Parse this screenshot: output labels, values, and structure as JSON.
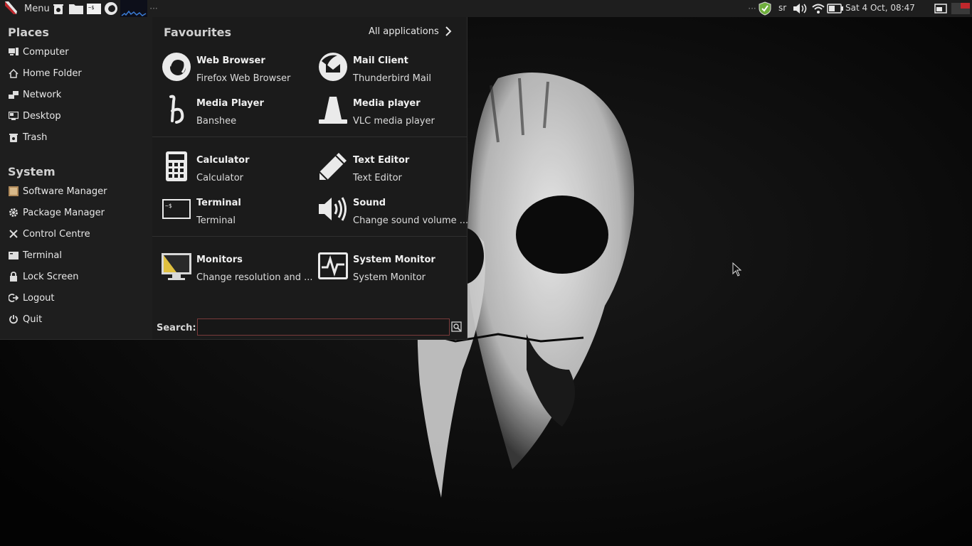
{
  "panel": {
    "menu_label": "Menu",
    "keyboard_layout": "sr",
    "clock": "Sat  4 Oct, 08:47",
    "launchers": [
      "trash-icon",
      "files-icon",
      "terminal-icon",
      "firefox-icon",
      "system-monitor-graph-icon"
    ],
    "tray": [
      "shield-icon",
      "volume-icon",
      "wifi-icon",
      "battery-icon",
      "workspace-icon",
      "display-icon"
    ]
  },
  "places": {
    "title": "Places",
    "items": [
      {
        "label": "Computer",
        "icon": "computer-icon"
      },
      {
        "label": "Home Folder",
        "icon": "home-icon"
      },
      {
        "label": "Network",
        "icon": "network-icon"
      },
      {
        "label": "Desktop",
        "icon": "desktop-icon"
      },
      {
        "label": "Trash",
        "icon": "trash-icon"
      }
    ]
  },
  "system": {
    "title": "System",
    "items": [
      {
        "label": "Software Manager",
        "icon": "software-manager-icon"
      },
      {
        "label": "Package Manager",
        "icon": "gear-icon"
      },
      {
        "label": "Control Centre",
        "icon": "tools-icon"
      },
      {
        "label": "Terminal",
        "icon": "terminal-icon"
      },
      {
        "label": "Lock Screen",
        "icon": "lock-icon"
      },
      {
        "label": "Logout",
        "icon": "logout-icon"
      },
      {
        "label": "Quit",
        "icon": "power-icon"
      }
    ]
  },
  "favourites": {
    "title": "Favourites",
    "all_apps": "All applications",
    "apps": [
      {
        "name": "Web Browser",
        "desc": "Firefox Web Browser",
        "icon": "firefox-icon"
      },
      {
        "name": "Mail Client",
        "desc": "Thunderbird Mail",
        "icon": "thunderbird-icon"
      },
      {
        "name": "Media Player",
        "desc": "Banshee",
        "icon": "banshee-icon"
      },
      {
        "name": "Media player",
        "desc": "VLC media player",
        "icon": "vlc-icon"
      },
      {
        "name": "Calculator",
        "desc": "Calculator",
        "icon": "calculator-icon"
      },
      {
        "name": "Text Editor",
        "desc": "Text Editor",
        "icon": "pencil-icon"
      },
      {
        "name": "Terminal",
        "desc": "Terminal",
        "icon": "terminal-icon"
      },
      {
        "name": "Sound",
        "desc": "Change sound volume ...",
        "icon": "speaker-icon"
      },
      {
        "name": "Monitors",
        "desc": "Change resolution and ...",
        "icon": "monitor-icon"
      },
      {
        "name": "System Monitor",
        "desc": "System Monitor",
        "icon": "system-monitor-icon"
      }
    ]
  },
  "search": {
    "label": "Search:",
    "value": "",
    "placeholder": ""
  },
  "colors": {
    "panel_bg": "#1e1e1e",
    "menu_bg": "#1e1e1e",
    "accent": "#c0282d"
  }
}
